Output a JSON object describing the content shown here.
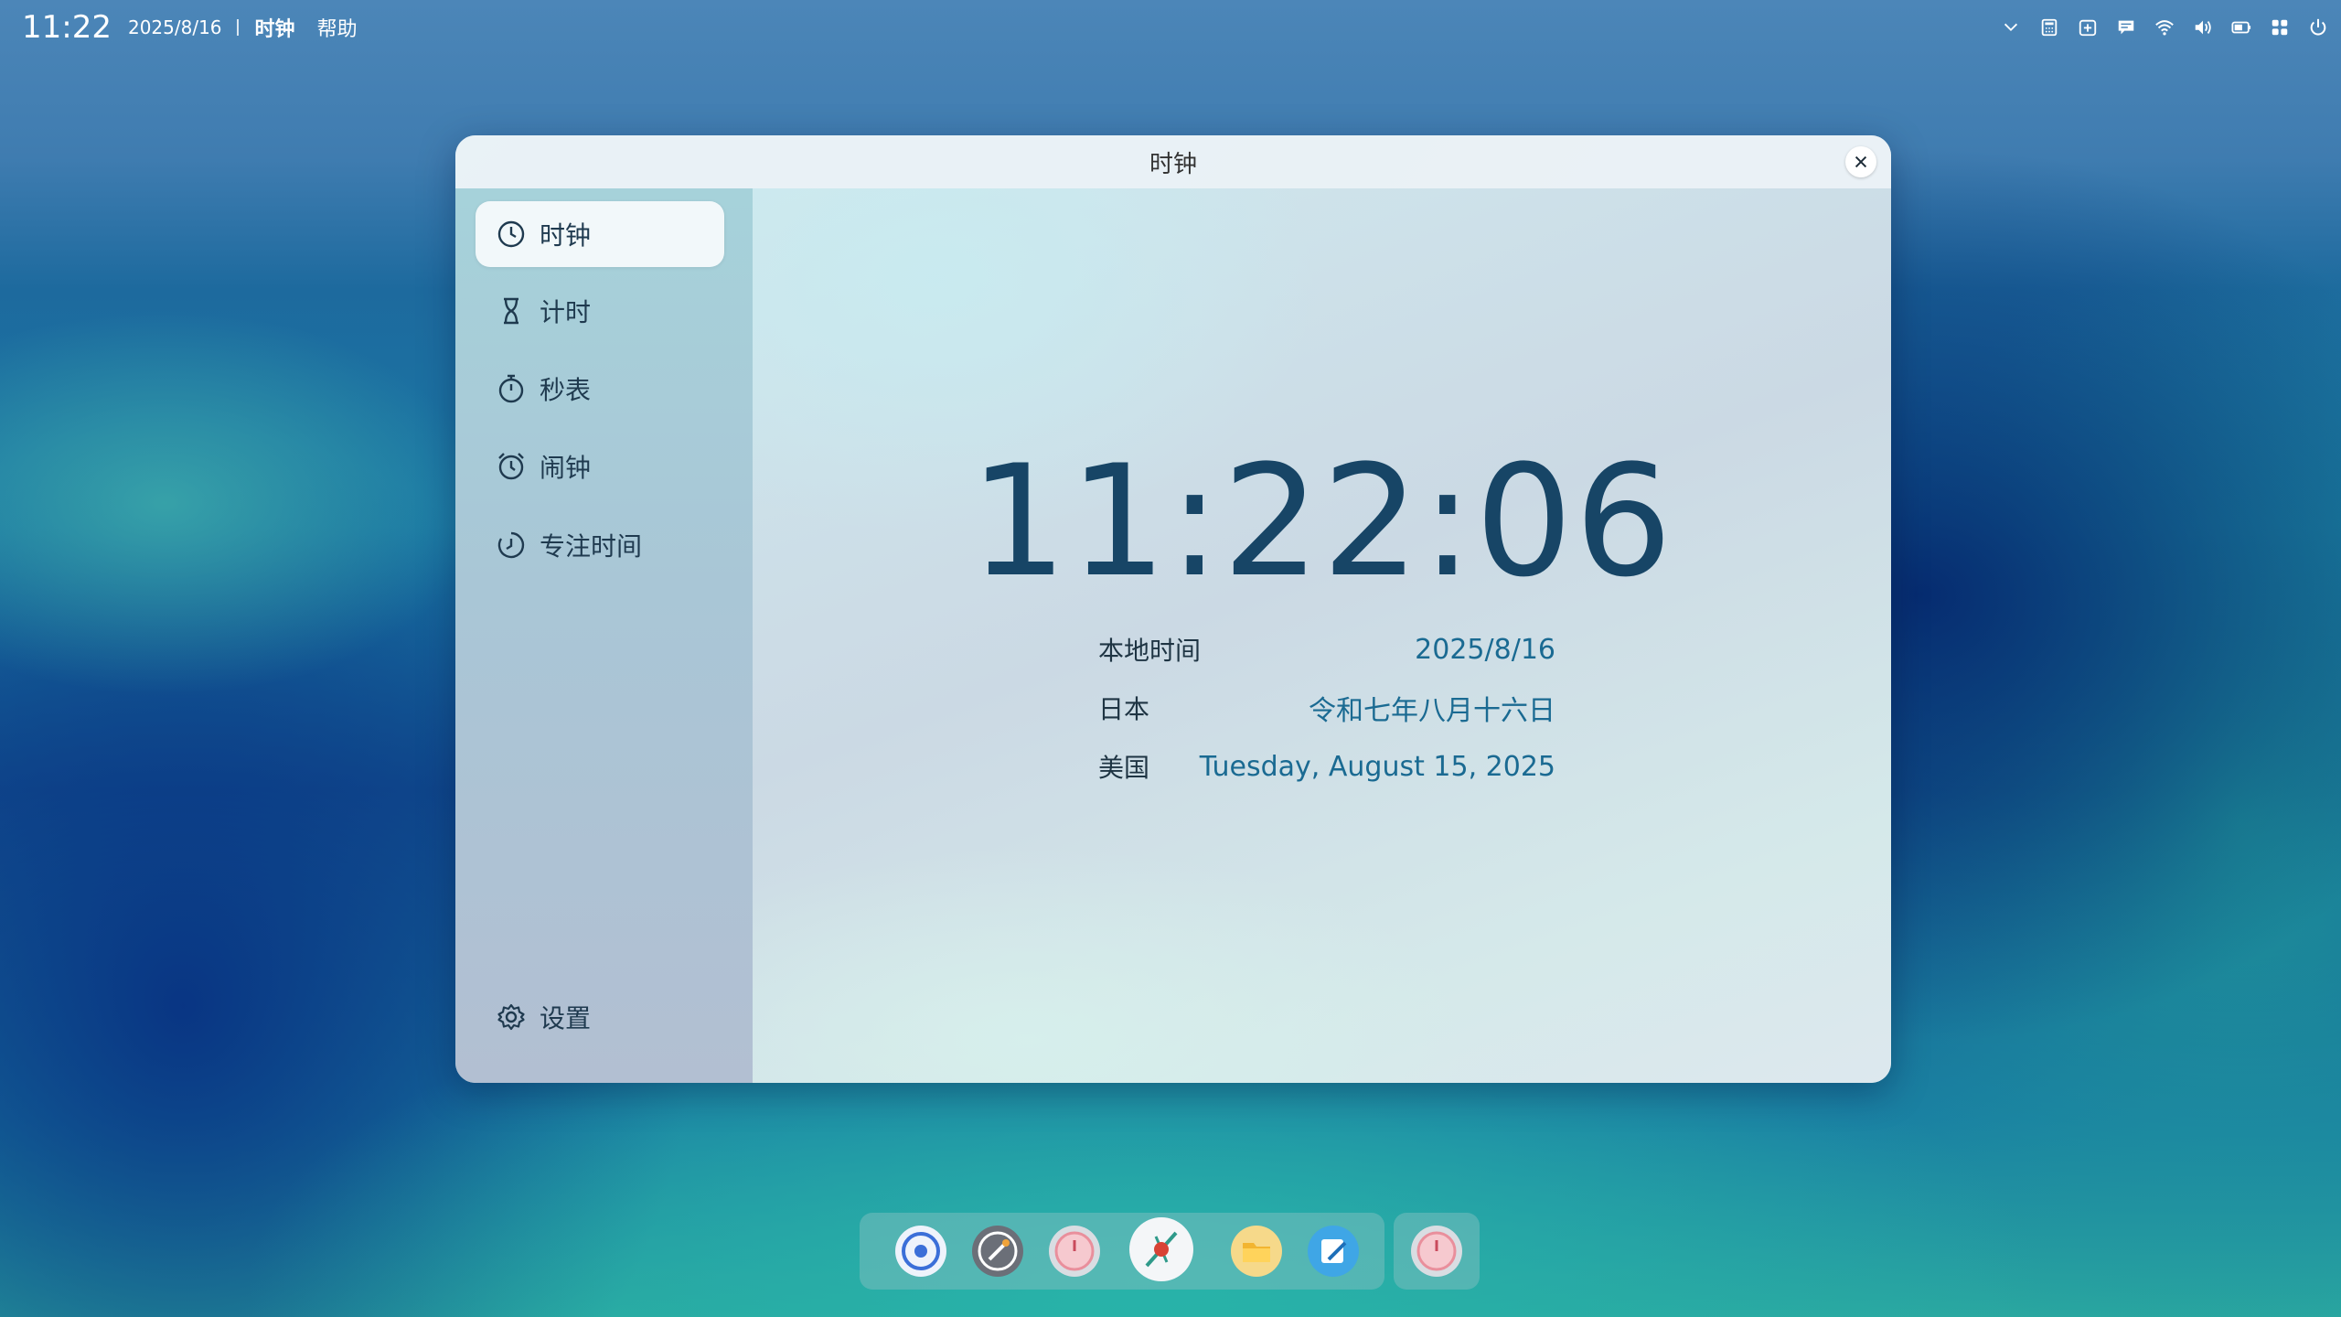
{
  "topbar": {
    "time": "11:22",
    "date": "2025/8/16",
    "app_name": "时钟",
    "help": "帮助",
    "tray_icons": [
      "chevron-down-icon",
      "calculator-icon",
      "calendar-icon",
      "chat-icon",
      "wifi-icon",
      "volume-icon",
      "battery-icon",
      "apps-grid-icon",
      "power-icon"
    ]
  },
  "window": {
    "title": "时钟",
    "close_icon": "close-icon"
  },
  "sidebar": {
    "items": [
      {
        "label": "时钟",
        "icon": "clock-icon"
      },
      {
        "label": "计时",
        "icon": "hourglass-icon"
      },
      {
        "label": "秒表",
        "icon": "stopwatch-icon"
      },
      {
        "label": "闹钟",
        "icon": "alarm-icon"
      },
      {
        "label": "专注时间",
        "icon": "focus-icon"
      }
    ],
    "settings": {
      "label": "设置",
      "icon": "gear-icon"
    }
  },
  "clock": {
    "time": "11:22:06",
    "rows": [
      {
        "label": "本地时间",
        "value": "2025/8/16"
      },
      {
        "label": "日本",
        "value": "令和七年八月十六日"
      },
      {
        "label": "美国",
        "value": "Tuesday, August 15, 2025"
      }
    ]
  },
  "dock": {
    "apps": [
      "browser-icon",
      "speed-icon",
      "clock-app-icon",
      "compass-icon",
      "folder-icon",
      "notes-icon"
    ],
    "running": [
      "clock-app-icon"
    ]
  },
  "colors": {
    "accent": "#174566",
    "value_text": "#1a6a92",
    "sidebar_top": "#a6d2da",
    "sidebar_bottom": "#b2bfd2"
  }
}
